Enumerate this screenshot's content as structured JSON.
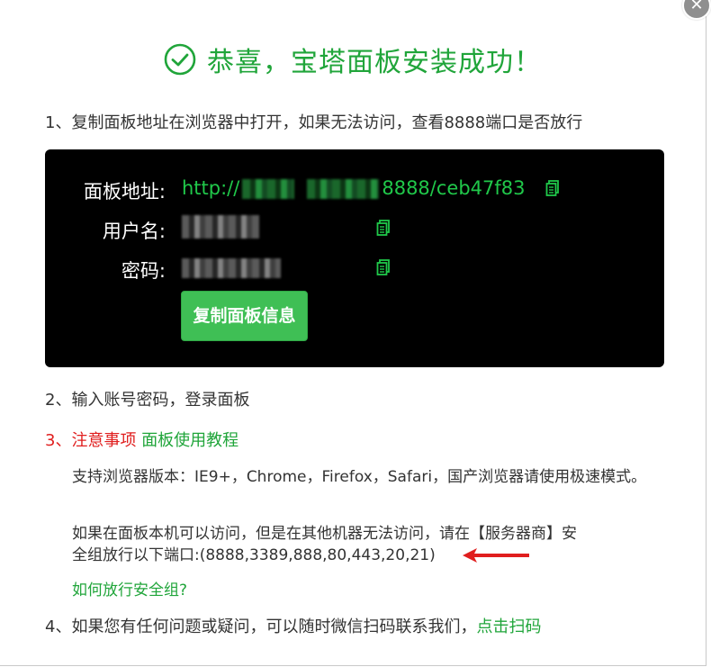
{
  "title": "恭喜，宝塔面板安装成功！",
  "step1": "1、复制面板地址在浏览器中打开，如果无法访问，查看8888端口是否放行",
  "info": {
    "address_label": "面板地址:",
    "address_prefix": "http://",
    "address_suffix": "8888/ceb47f83",
    "username_label": "用户名:",
    "password_label": "密码:",
    "copy_button": "复制面板信息"
  },
  "step2": "2、输入账号密码，登录面板",
  "step3": {
    "prefix": "3、注意事项",
    "link": "面板使用教程"
  },
  "note_browser": "支持浏览器版本：IE9+，Chrome，Firefox，Safari，国产浏览器请使用极速模式。",
  "note_ports_line1": "如果在面板本机可以访问，但是在其他机器无法访问，请在【服务器商】安",
  "note_ports_line2": "全组放行以下端口:(8888,3389,888,80,443,20,21)",
  "security_group_link": "如何放行安全组?",
  "step4": {
    "text": "4、如果您有任何问题或疑问，可以随时微信扫码联系我们，",
    "link": "点击扫码"
  },
  "colors": {
    "brand_green": "#20a53a",
    "warning_red": "#e01e1e",
    "panel_bg": "#000000"
  },
  "icons": {
    "title": "check-circle-icon",
    "copy": "copy-icon",
    "close": "close-icon",
    "arrow": "arrow-left-icon"
  }
}
